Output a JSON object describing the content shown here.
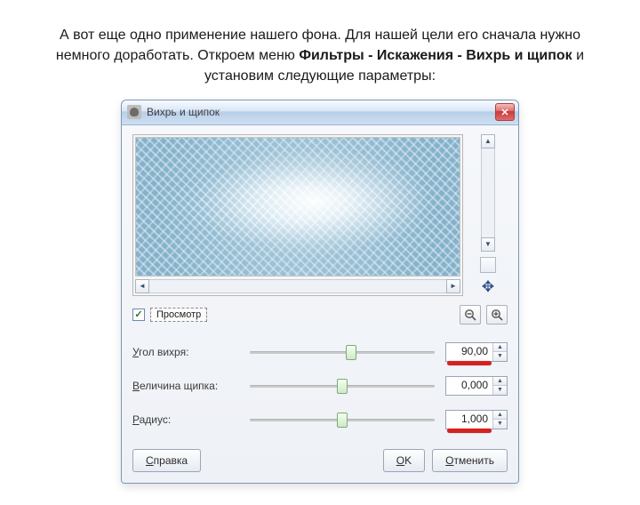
{
  "caption": {
    "part1": "А вот еще одно применение нашего фона. Для нашей цели его сначала нужно немного доработать. Откроем меню ",
    "bold": "Фильтры - Искажения - Вихрь и щипок",
    "part2": " и установим следующие параметры:"
  },
  "dialog": {
    "title": "Вихрь и щипок",
    "close_glyph": "✕",
    "preview_checkbox_label": "Просмотр",
    "preview_checked": true,
    "parameters": [
      {
        "label_pre": "У",
        "label_rest": "гол вихря:",
        "value": "90,00",
        "thumb_pct": 55
      },
      {
        "label_pre": "В",
        "label_rest": "еличина щипка:",
        "value": "0,000",
        "thumb_pct": 50
      },
      {
        "label_pre": "Р",
        "label_rest": "адиус:",
        "value": "1,000",
        "thumb_pct": 50
      }
    ],
    "buttons": {
      "help_pre": "С",
      "help_rest": "правка",
      "ok_pre": "O",
      "ok_rest": "K",
      "cancel_pre": "О",
      "cancel_rest": "тменить"
    }
  }
}
